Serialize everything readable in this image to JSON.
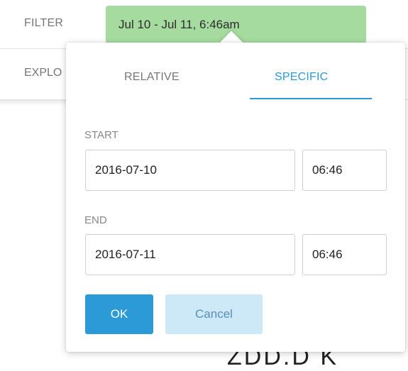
{
  "background": {
    "filter_label": "FILTER",
    "explore_label": "EXPLO",
    "bottom_text": "ZDD.D K"
  },
  "filter_chip": {
    "label": "Jul 10 - Jul 11, 6:46am"
  },
  "popover": {
    "tabs": [
      {
        "label": "RELATIVE",
        "active": false
      },
      {
        "label": "SPECIFIC",
        "active": true
      }
    ],
    "start": {
      "label": "START",
      "date": "2016-07-10",
      "time": "06:46"
    },
    "end": {
      "label": "END",
      "date": "2016-07-11",
      "time": "06:46"
    },
    "ok_label": "OK",
    "cancel_label": "Cancel"
  },
  "colors": {
    "chip": "#a6dba0",
    "accent": "#2b9ad6",
    "cancel_bg": "#cde8f7"
  }
}
